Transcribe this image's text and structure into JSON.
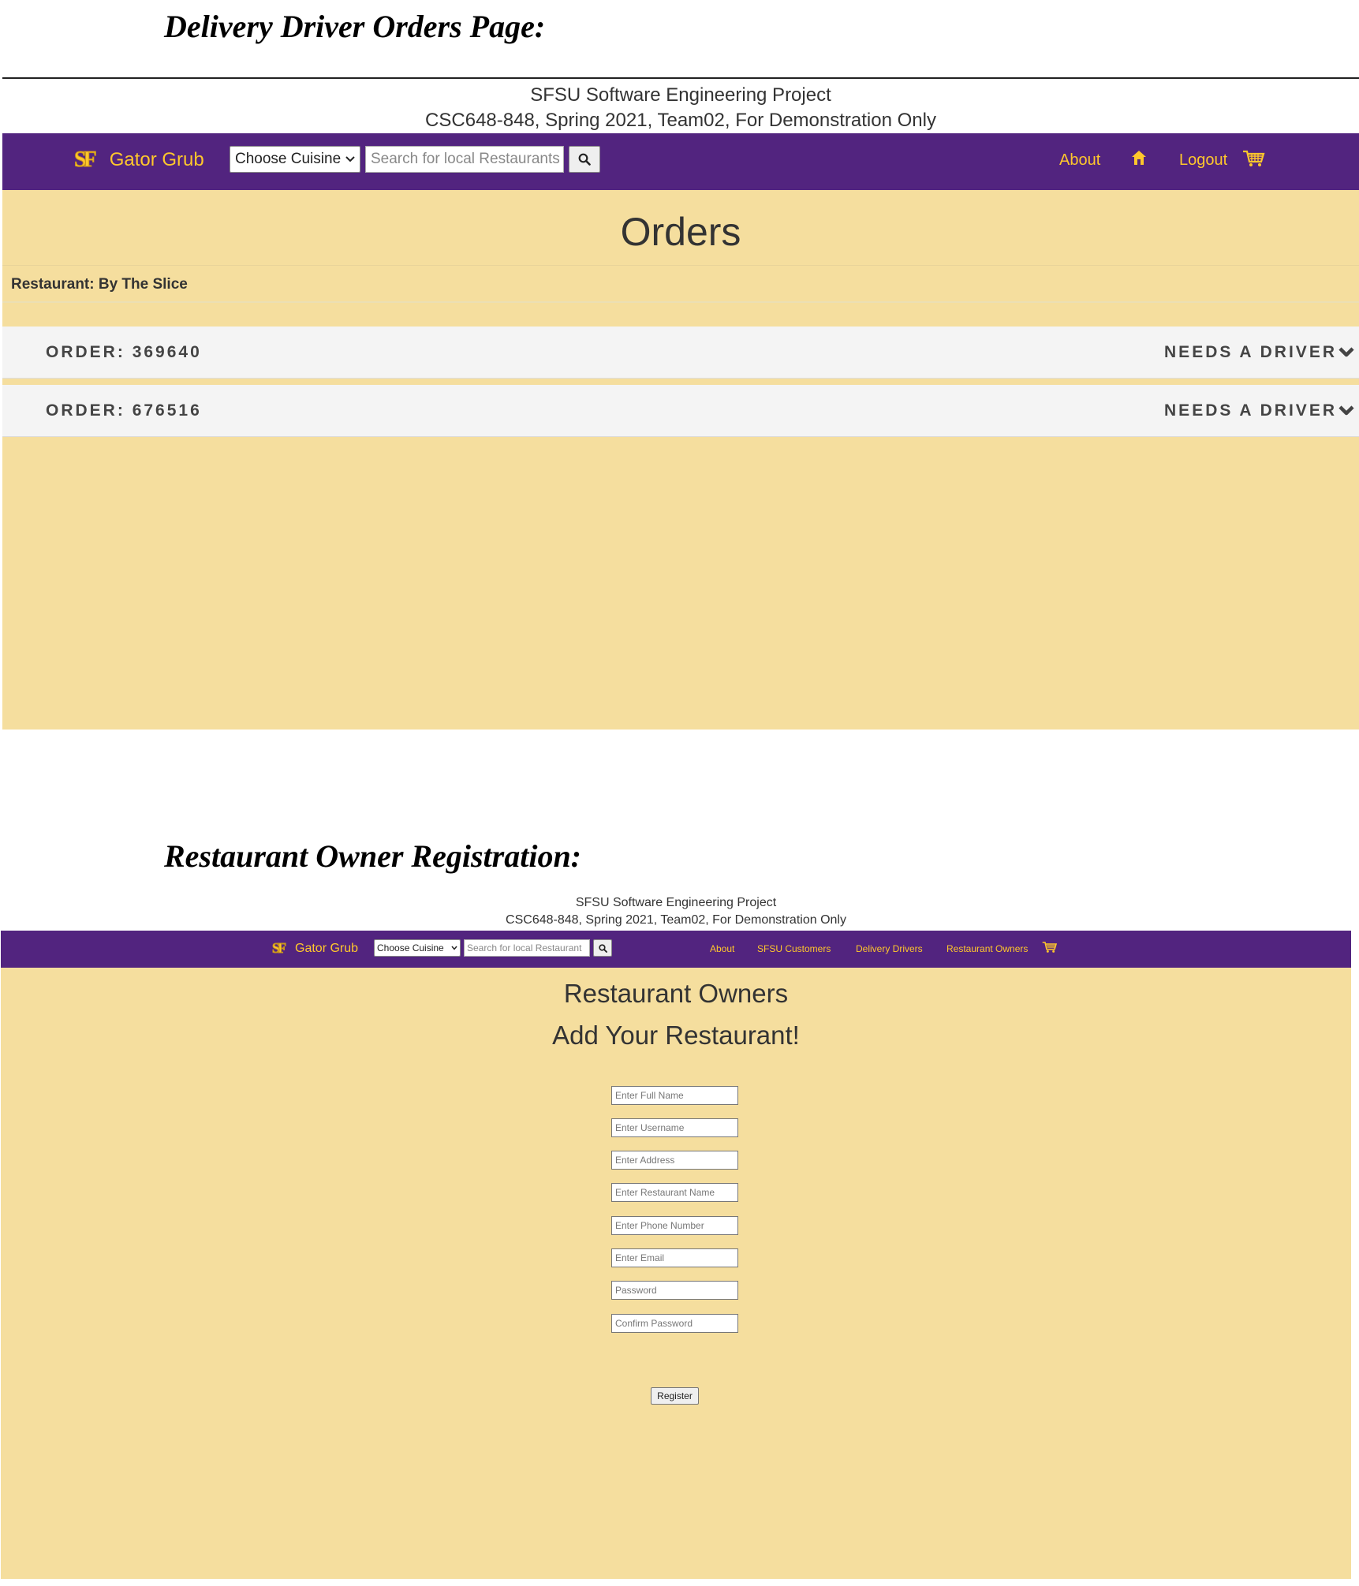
{
  "headings": {
    "driver_orders": "Delivery Driver Orders Page:",
    "owner_registration": "Restaurant Owner Registration:"
  },
  "project_header": {
    "line1": "SFSU Software Engineering Project",
    "line2": "CSC648-848, Spring 2021, Team02, For Demonstration Only"
  },
  "brand": {
    "logo_text": "SF",
    "name": "Gator Grub"
  },
  "search": {
    "cuisine_selected": "Choose Cuisine",
    "placeholder": "Search for local Restaurants",
    "placeholder_short": "Search for local Restaurant"
  },
  "colors": {
    "nav_purple": "#52247f",
    "nav_gold": "#ffc72c",
    "content_bg": "#f5de9e",
    "row_bg": "#f4f4f4"
  },
  "driver_page": {
    "nav": {
      "about": "About",
      "home_icon": "home-icon",
      "logout": "Logout",
      "cart_icon": "cart-icon"
    },
    "title": "Orders",
    "restaurant_label": "Restaurant: By The Slice",
    "orders": [
      {
        "label": "ORDER:",
        "id": "369640",
        "status": "NEEDS A DRIVER"
      },
      {
        "label": "ORDER:",
        "id": "676516",
        "status": "NEEDS A DRIVER"
      }
    ]
  },
  "owner_page": {
    "nav": {
      "about": "About",
      "customers": "SFSU Customers",
      "drivers": "Delivery Drivers",
      "owners": "Restaurant Owners",
      "cart_icon": "cart-icon"
    },
    "title": "Restaurant Owners",
    "subtitle": "Add Your Restaurant!",
    "fields": [
      "Enter Full Name",
      "Enter Username",
      "Enter Address",
      "Enter Restaurant Name",
      "Enter Phone Number",
      "Enter Email",
      "Password",
      "Confirm Password"
    ],
    "register_label": "Register"
  }
}
